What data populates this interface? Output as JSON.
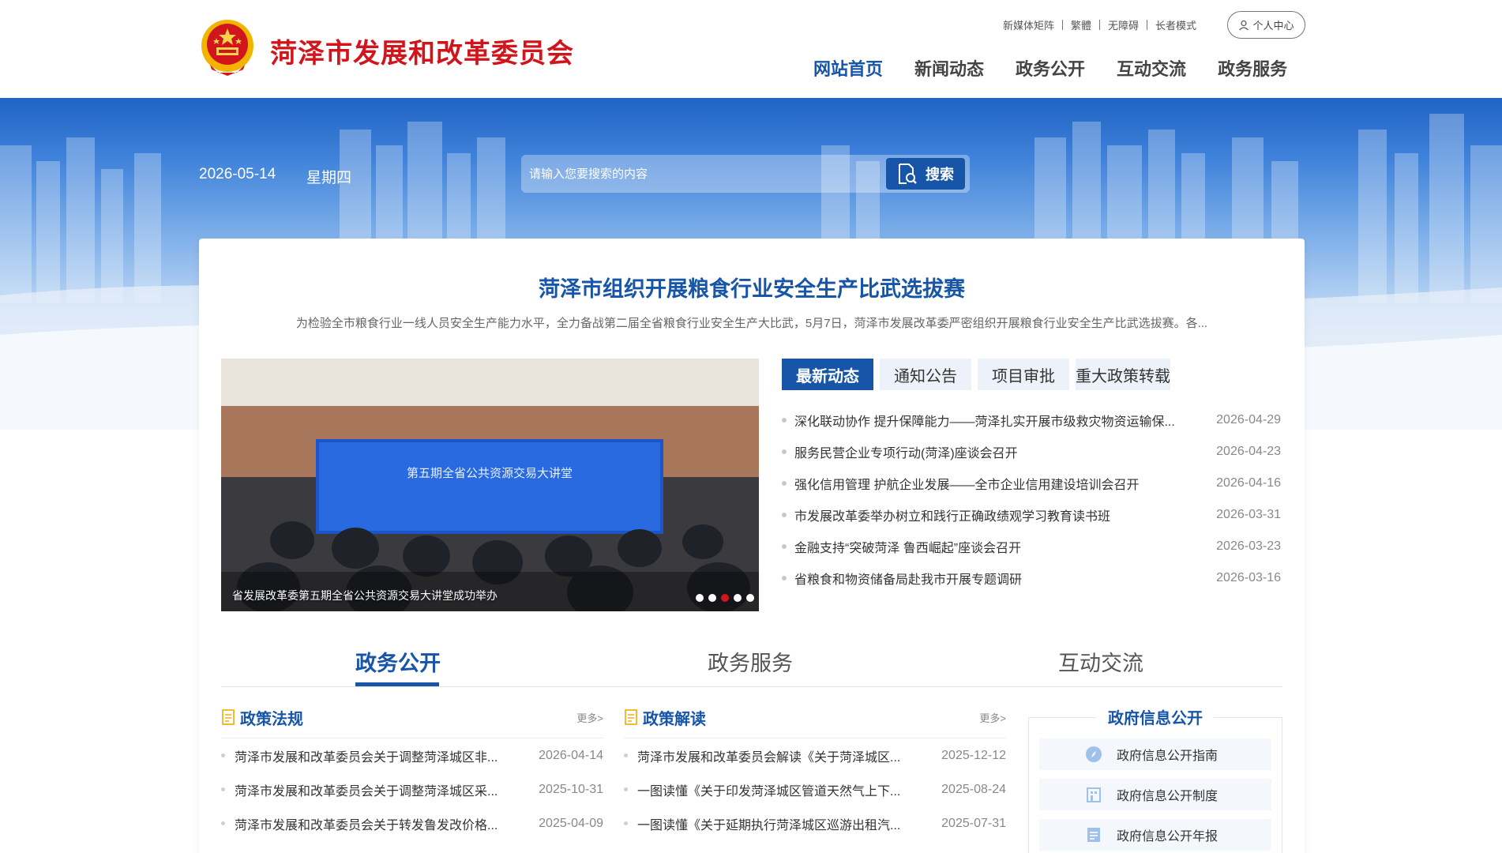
{
  "header": {
    "site_title": "菏泽市发展和改革委员会",
    "top_links": [
      "新媒体矩阵",
      "繁體",
      "无障碍",
      "长者模式"
    ],
    "user_center": "个人中心",
    "nav": [
      "网站首页",
      "新闻动态",
      "政务公开",
      "互动交流",
      "政务服务"
    ]
  },
  "banner": {
    "date": "2026-05-14",
    "weekday": "星期四",
    "search_placeholder": "请输入您要搜索的内容",
    "search_button": "搜索"
  },
  "headline": {
    "title": "菏泽市组织开展粮食行业安全生产比武选拔赛",
    "summary": "为检验全市粮食行业一线人员安全生产能力水平，全力备战第二届全省粮食行业安全生产大比武，5月7日，菏泽市发展改革委严密组织开展粮食行业安全生产比武选拔赛。各..."
  },
  "carousel": {
    "screen_text": "第五期全省公共资源交易大讲堂",
    "caption": "省发展改革委第五期全省公共资源交易大讲堂成功举办",
    "dot_count": 5,
    "active_dot": 3
  },
  "news_tabs": [
    "最新动态",
    "通知公告",
    "项目审批",
    "重大政策转载"
  ],
  "news": [
    {
      "title": "深化联动协作 提升保障能力——菏泽扎实开展市级救灾物资运输保...",
      "date": "2026-04-29"
    },
    {
      "title": "服务民营企业专项行动(菏泽)座谈会召开",
      "date": "2026-04-23"
    },
    {
      "title": "强化信用管理 护航企业发展——全市企业信用建设培训会召开",
      "date": "2026-04-16"
    },
    {
      "title": "市发展改革委举办树立和践行正确政绩观学习教育读书班",
      "date": "2026-03-31"
    },
    {
      "title": "金融支持“突破菏泽 鲁西崛起”座谈会召开",
      "date": "2026-03-23"
    },
    {
      "title": "省粮食和物资储备局赴我市开展专题调研",
      "date": "2026-03-16"
    }
  ],
  "section_tabs": [
    "政务公开",
    "政务服务",
    "互动交流"
  ],
  "policy": {
    "title": "政策法规",
    "more": "更多>",
    "items": [
      {
        "title": "菏泽市发展和改革委员会关于调整菏泽城区非...",
        "date": "2026-04-14"
      },
      {
        "title": "菏泽市发展和改革委员会关于调整菏泽城区采...",
        "date": "2025-10-31"
      },
      {
        "title": "菏泽市发展和改革委员会关于转发鲁发改价格...",
        "date": "2025-04-09"
      }
    ]
  },
  "interpret": {
    "title": "政策解读",
    "more": "更多>",
    "items": [
      {
        "title": "菏泽市发展和改革委员会解读《关于菏泽城区...",
        "date": "2025-12-12"
      },
      {
        "title": "一图读懂《关于印发菏泽城区管道天然气上下...",
        "date": "2025-08-24"
      },
      {
        "title": "一图读懂《关于延期执行菏泽城区巡游出租汽...",
        "date": "2025-07-31"
      }
    ]
  },
  "gov_info": {
    "title": "政府信息公开",
    "items": [
      "政府信息公开指南",
      "政府信息公开制度",
      "政府信息公开年报"
    ]
  },
  "colors": {
    "brand_red": "#d0161c",
    "brand_blue": "#1755a8"
  }
}
